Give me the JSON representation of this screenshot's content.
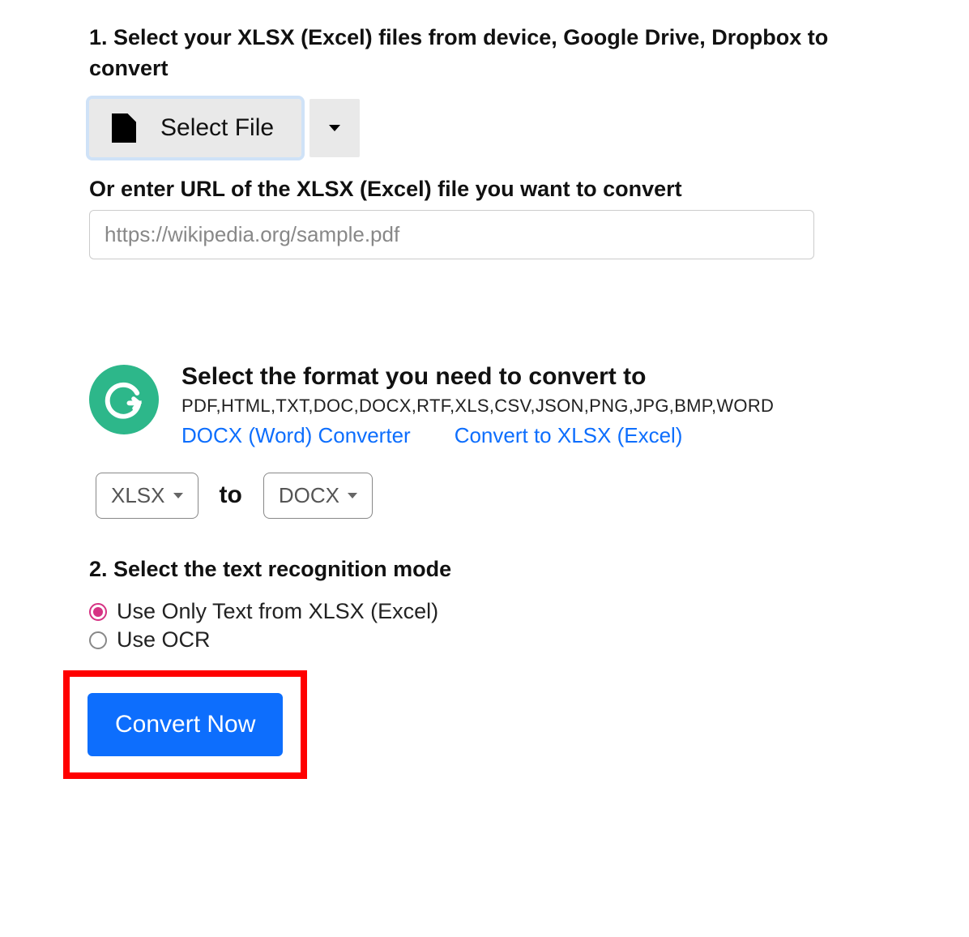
{
  "step1": {
    "heading": "1. Select your XLSX (Excel) files from device, Google Drive, Dropbox to convert",
    "select_file_label": "Select File",
    "url_label": "Or enter URL of the XLSX (Excel) file you want to convert",
    "url_placeholder": "https://wikipedia.org/sample.pdf"
  },
  "format_section": {
    "title": "Select the format you need to convert to",
    "formats": "PDF,HTML,TXT,DOC,DOCX,RTF,XLS,CSV,JSON,PNG,JPG,BMP,WORD",
    "link1": "DOCX (Word) Converter",
    "link2": "Convert to XLSX (Excel)",
    "from_format": "XLSX",
    "to_label": "to",
    "to_format": "DOCX"
  },
  "step2": {
    "heading": "2. Select the text recognition mode",
    "option1": "Use Only Text from XLSX (Excel)",
    "option2": "Use OCR"
  },
  "actions": {
    "convert_now": "Convert Now"
  }
}
